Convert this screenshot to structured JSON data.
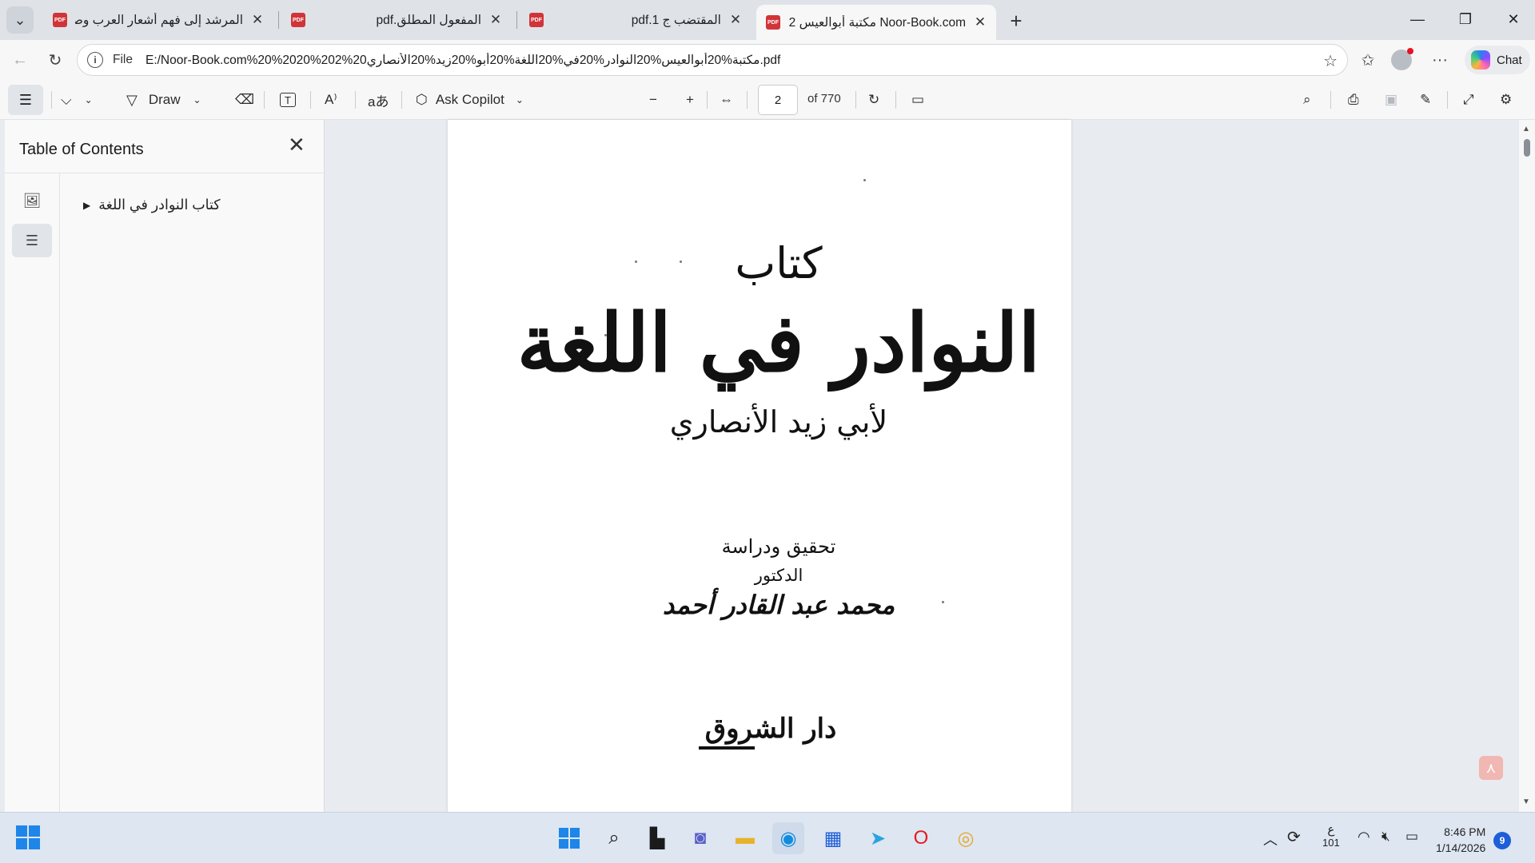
{
  "window": {
    "tabs": [
      {
        "title": "المرشد إلى فهم أشعار العرب وصناعتها",
        "active": false
      },
      {
        "title": "المفعول المطلق.pdf",
        "active": false
      },
      {
        "title": "المقتضب ج 1.pdf",
        "active": false
      },
      {
        "title": "Noor-Book.com مكتبة أبوالعيس 2",
        "active": true
      }
    ],
    "controls": {
      "minimize": "—",
      "maximize": "❐",
      "close": "✕"
    }
  },
  "address_bar": {
    "scheme": "File",
    "url": "E:/Noor-Book.com%20%2020%202%20مكتبة%20أبوالعيس%20النوادر%20في%20اللغة%20أبو%20زيد%20الأنصاري.pdf",
    "chat_label": "Chat"
  },
  "pdf_toolbar": {
    "draw_label": "Draw",
    "copilot_label": "Ask Copilot",
    "page_number": "2",
    "page_total": "of 770"
  },
  "toc": {
    "title": "Table of Contents",
    "items": [
      {
        "label": "كتاب النوادر في اللغة"
      }
    ]
  },
  "page_content": {
    "line1": "كتاب",
    "line2": "النوادر في اللغة",
    "line3": "لأبي زيد الأنصاري",
    "line4": "تحقيق ودراسة",
    "line5": "الدكتور",
    "line6": "محمد عبد القادر أحمد",
    "line7": "دار الشروق"
  },
  "taskbar": {
    "tray": {
      "keyboard_lang": "ع",
      "keyboard_code": "101",
      "time": "8:46 PM",
      "date": "1/14/2026",
      "notifications": "9"
    }
  },
  "colors": {
    "accent": "#1e86e8",
    "pdf_icon": "#d13438",
    "page_bg": "#ffffff",
    "canvas_bg": "#e8ebef"
  }
}
